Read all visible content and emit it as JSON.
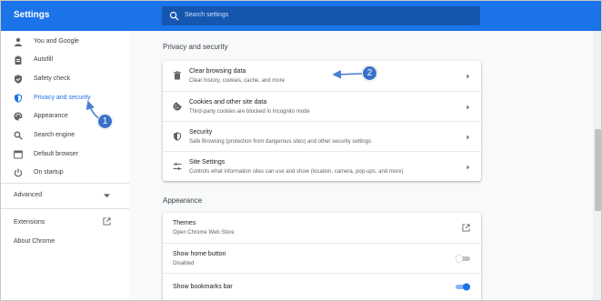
{
  "app": {
    "title": "Settings"
  },
  "search": {
    "placeholder": "Search settings",
    "icon": "search-icon"
  },
  "sidebar": {
    "items": [
      {
        "label": "You and Google",
        "icon": "person-icon",
        "active": false
      },
      {
        "label": "Autofill",
        "icon": "clipboard-icon",
        "active": false
      },
      {
        "label": "Safety check",
        "icon": "shield-check-icon",
        "active": false
      },
      {
        "label": "Privacy and security",
        "icon": "shield-half-icon",
        "active": true
      },
      {
        "label": "Appearance",
        "icon": "palette-icon",
        "active": false
      },
      {
        "label": "Search engine",
        "icon": "search-icon",
        "active": false
      },
      {
        "label": "Default browser",
        "icon": "browser-icon",
        "active": false
      },
      {
        "label": "On startup",
        "icon": "power-icon",
        "active": false
      }
    ],
    "advanced": "Advanced",
    "extensions": "Extensions",
    "about": "About Chrome"
  },
  "privacy": {
    "title": "Privacy and security",
    "rows": [
      {
        "title": "Clear browsing data",
        "subtitle": "Clear history, cookies, cache, and more",
        "icon": "trash-icon"
      },
      {
        "title": "Cookies and other site data",
        "subtitle": "Third-party cookies are blocked in Incognito mode",
        "icon": "cookie-icon"
      },
      {
        "title": "Security",
        "subtitle": "Safe Browsing (protection from dangerous sites) and other security settings",
        "icon": "shield-half-icon"
      },
      {
        "title": "Site Settings",
        "subtitle": "Controls what information sites can use and show (location, camera, pop-ups, and more)",
        "icon": "tune-icon"
      }
    ]
  },
  "appearance": {
    "title": "Appearance",
    "rows": [
      {
        "title": "Themes",
        "subtitle": "Open Chrome Web Store",
        "control": "external-link-icon"
      },
      {
        "title": "Show home button",
        "subtitle": "Disabled",
        "control": "toggle",
        "on": false
      },
      {
        "title": "Show bookmarks bar",
        "subtitle": "",
        "control": "toggle",
        "on": true
      }
    ]
  },
  "callouts": [
    "1",
    "2"
  ],
  "colors": {
    "accent": "#1a73e8",
    "topbar": "#1a73e8",
    "search_bg": "#1557b0",
    "callout": "#3a70c8",
    "arrow": "#4a7fd4"
  }
}
